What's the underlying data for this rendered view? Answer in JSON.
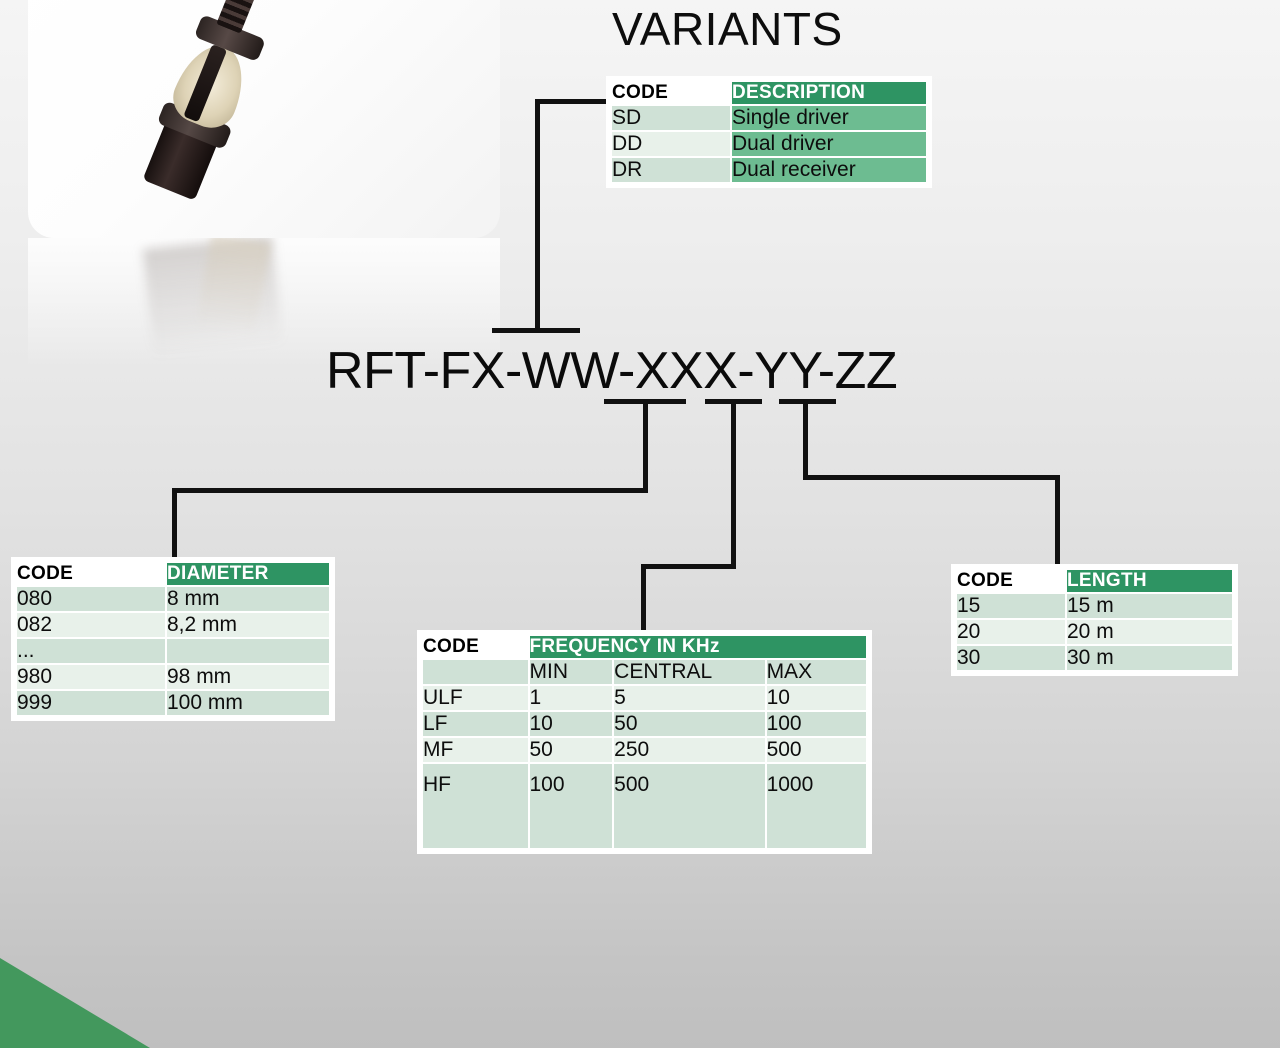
{
  "page": {
    "title": "VARIANTS",
    "code_pattern": "RFT-FX-WW-XXX-YY-ZZ",
    "background_gradient_from": "#f5f5f5",
    "background_gradient_to": "#bfbfbf",
    "accent_green": "#2e9463",
    "accent_green_mid": "#6dbc91",
    "cell_green_dark": "#cfe1d6",
    "cell_green_light": "#e8f1ea",
    "corner_green": "#43985d"
  },
  "variants_table": {
    "name": "variants",
    "headers": [
      "CODE",
      "DESCRIPTION"
    ],
    "rows": [
      {
        "code": "SD",
        "description": "Single driver"
      },
      {
        "code": "DD",
        "description": "Dual driver"
      },
      {
        "code": "DR",
        "description": "Dual receiver"
      }
    ]
  },
  "diameter_table": {
    "name": "diameter",
    "headers": [
      "CODE",
      "DIAMETER"
    ],
    "rows": [
      {
        "code": "080",
        "value": "8 mm"
      },
      {
        "code": "082",
        "value": "8,2 mm"
      },
      {
        "code": "...",
        "value": ""
      },
      {
        "code": "980",
        "value": "98 mm"
      },
      {
        "code": "999",
        "value": "100 mm"
      }
    ]
  },
  "frequency_table": {
    "name": "frequency",
    "headers": [
      "CODE",
      "FREQUENCY IN KHz"
    ],
    "subheaders": [
      "",
      "MIN",
      "CENTRAL",
      "MAX"
    ],
    "rows": [
      {
        "code": "ULF",
        "min": "1",
        "central": "5",
        "max": "10"
      },
      {
        "code": "LF",
        "min": "10",
        "central": "50",
        "max": "100"
      },
      {
        "code": "MF",
        "min": "50",
        "central": "250",
        "max": "500"
      },
      {
        "code": "HF",
        "min": "100",
        "central": "500",
        "max": "1000"
      }
    ]
  },
  "length_table": {
    "name": "length",
    "headers": [
      "CODE",
      "LENGTH"
    ],
    "rows": [
      {
        "code": "15",
        "value": "15 m"
      },
      {
        "code": "20",
        "value": "20 m"
      },
      {
        "code": "30",
        "value": "30 m"
      }
    ]
  },
  "product_image": {
    "alt": "fiber optic connector assembly photo"
  }
}
